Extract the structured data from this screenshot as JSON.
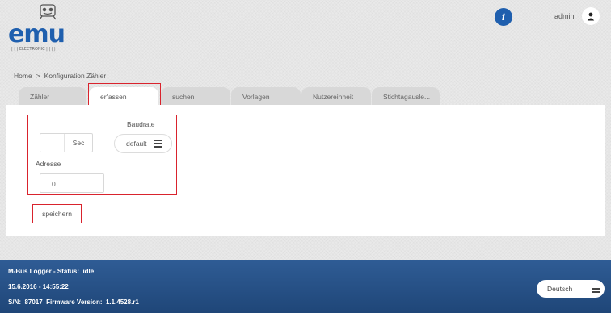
{
  "header": {
    "logo_text": "emu",
    "logo_subtext": "ELECTRONIC",
    "info_label": "i",
    "user_name": "admin",
    "icons": {
      "info": "info-icon",
      "user": "user-icon"
    }
  },
  "breadcrumb": {
    "home": "Home",
    "separator": ">",
    "current": "Konfiguration Zähler"
  },
  "tabs": [
    {
      "label": "Zähler"
    },
    {
      "label": "erfassen",
      "active": true
    },
    {
      "label": "suchen"
    },
    {
      "label": "Vorlagen"
    },
    {
      "label": "Nutzereinheit"
    },
    {
      "label": "Stichtagausle..."
    }
  ],
  "form": {
    "sec_value": "",
    "sec_unit": "Sec",
    "baud_label": "Baudrate",
    "baud_value": "default",
    "address_label": "Adresse",
    "address_value": "0",
    "save_label": "speichern"
  },
  "footer": {
    "status_line": "M-Bus Logger - Status:  idle",
    "datetime": "15.6.2016 - 14:55:22",
    "serial_line": "S/N:  87017  Firmware Version:  1.1.4528.r1",
    "language": "Deutsch"
  },
  "colors": {
    "accent": "#1f5fae",
    "highlight": "#d9232d",
    "footer_bg": "#244f86"
  }
}
